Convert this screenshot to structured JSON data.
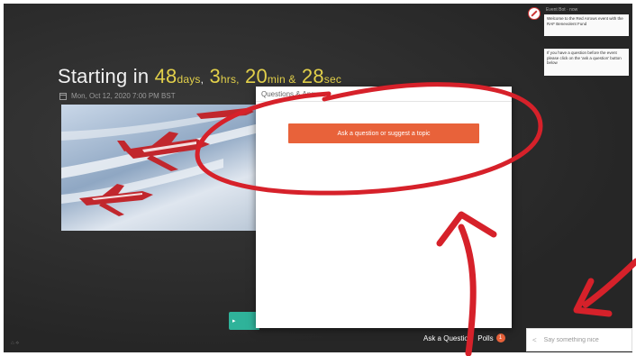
{
  "countdown": {
    "prefix": "Starting in",
    "days_value": "48",
    "days_unit": "days",
    "comma": ",",
    "hours_value": "3",
    "hours_unit": "hrs,",
    "minutes_value": "20",
    "minutes_unit": "min &",
    "seconds_value": "28",
    "seconds_unit": "sec",
    "date": "Mon, Oct 12, 2020 7:00 PM BST"
  },
  "qa": {
    "title": "Questions & Answers",
    "ask_button": "Ask a question or suggest a topic"
  },
  "bottom": {
    "ask_label": "Ask a Question",
    "polls_label": "Polls",
    "polls_count": "1"
  },
  "chat": {
    "placeholder": "Say something nice"
  },
  "notification": {
    "header": "Event Bot · now",
    "message_1": "Welcome to the Red Arrows event with the RAF Benevolent Fund",
    "message_2": "If you have a question before the event please click on the 'ask a question' button below"
  },
  "colors": {
    "accent": "#e8623a",
    "countdown": "#e2d04a",
    "annotation": "#d6212a",
    "green": "#2fb39a"
  }
}
